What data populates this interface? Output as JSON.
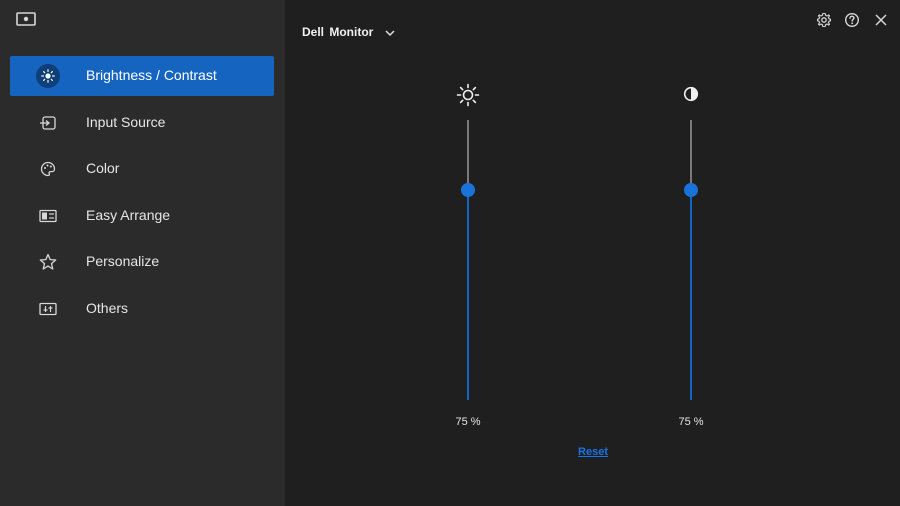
{
  "app": {
    "logo_icon": "monitor-icon"
  },
  "header": {
    "title": "Dell  Monitor",
    "dropdown_icon": "chevron-down-icon",
    "controls": [
      "settings-gear-icon",
      "help-icon",
      "close-icon"
    ]
  },
  "sidebar": {
    "items": [
      {
        "label": "Brightness / Contrast",
        "icon": "brightness-icon",
        "active": true
      },
      {
        "label": "Input Source",
        "icon": "input-source-icon",
        "active": false
      },
      {
        "label": "Color",
        "icon": "color-palette-icon",
        "active": false
      },
      {
        "label": "Easy Arrange",
        "icon": "easy-arrange-icon",
        "active": false
      },
      {
        "label": "Personalize",
        "icon": "star-icon",
        "active": false
      },
      {
        "label": "Others",
        "icon": "others-icon",
        "active": false
      }
    ]
  },
  "main": {
    "brightness": {
      "icon": "sun-icon",
      "value": 75,
      "value_text": "75 %"
    },
    "contrast": {
      "icon": "contrast-icon",
      "value": 75,
      "value_text": "75 %"
    },
    "reset_label": "Reset"
  },
  "colors": {
    "accent": "#1565c0",
    "slider_thumb": "#1a73d9",
    "sidebar_bg": "#2b2b2b",
    "main_bg": "#1f1f1f"
  }
}
